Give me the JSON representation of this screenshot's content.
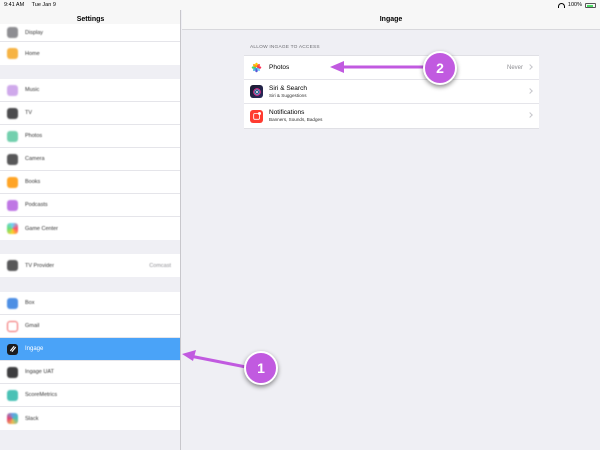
{
  "status_bar": {
    "time": "9:41 AM",
    "date": "Tue Jan 9",
    "battery": "100%"
  },
  "sidebar": {
    "title": "Settings",
    "groups": [
      {
        "items": [
          {
            "label": "Display",
            "color": "#7a7a7f",
            "selected": false
          },
          {
            "label": "Home",
            "color": "#f5a623",
            "selected": false
          }
        ]
      },
      {
        "items": [
          {
            "label": "Music",
            "color": "#c79be8",
            "selected": false
          },
          {
            "label": "TV",
            "color": "#2c2c2e",
            "selected": false
          },
          {
            "label": "Photos",
            "color": "#5ac8a0",
            "selected": false
          },
          {
            "label": "Camera",
            "color": "#3a3a3c",
            "selected": false
          },
          {
            "label": "Books",
            "color": "#ff9500",
            "selected": false
          },
          {
            "label": "Podcasts",
            "color": "#b45fe0",
            "selected": false
          },
          {
            "label": "Game Center",
            "color": "#5ac8fa",
            "selected": false
          }
        ]
      },
      {
        "items": [
          {
            "label": "TV Provider",
            "value": "Comcast",
            "color": "#3a3a3c",
            "selected": false
          }
        ]
      },
      {
        "items": [
          {
            "label": "Box",
            "color": "#2f7ce0",
            "selected": false
          },
          {
            "label": "Gmail",
            "color": "#ffffff",
            "selected": false
          },
          {
            "label": "Ingage",
            "color": "#1c1c1e",
            "selected": true
          },
          {
            "label": "Ingage UAT",
            "color": "#1c1c1e",
            "selected": false
          },
          {
            "label": "ScoreMetrics",
            "color": "#2ab7a9",
            "selected": false
          },
          {
            "label": "Slack",
            "color": "#4a90e2",
            "selected": false
          }
        ]
      }
    ]
  },
  "detail": {
    "title": "Ingage",
    "section_title": "ALLOW INGAGE TO ACCESS",
    "rows": [
      {
        "title": "Photos",
        "subtitle": "",
        "value": "Never",
        "icon": "photos-icon"
      },
      {
        "title": "Siri & Search",
        "subtitle": "Siri & Suggestions",
        "value": "",
        "icon": "siri-icon"
      },
      {
        "title": "Notifications",
        "subtitle": "Banners, Sounds, Badges",
        "value": "",
        "icon": "notifications-icon"
      }
    ]
  },
  "annotations": {
    "badge_1": "1",
    "badge_2": "2",
    "color": "#c15ae0"
  }
}
